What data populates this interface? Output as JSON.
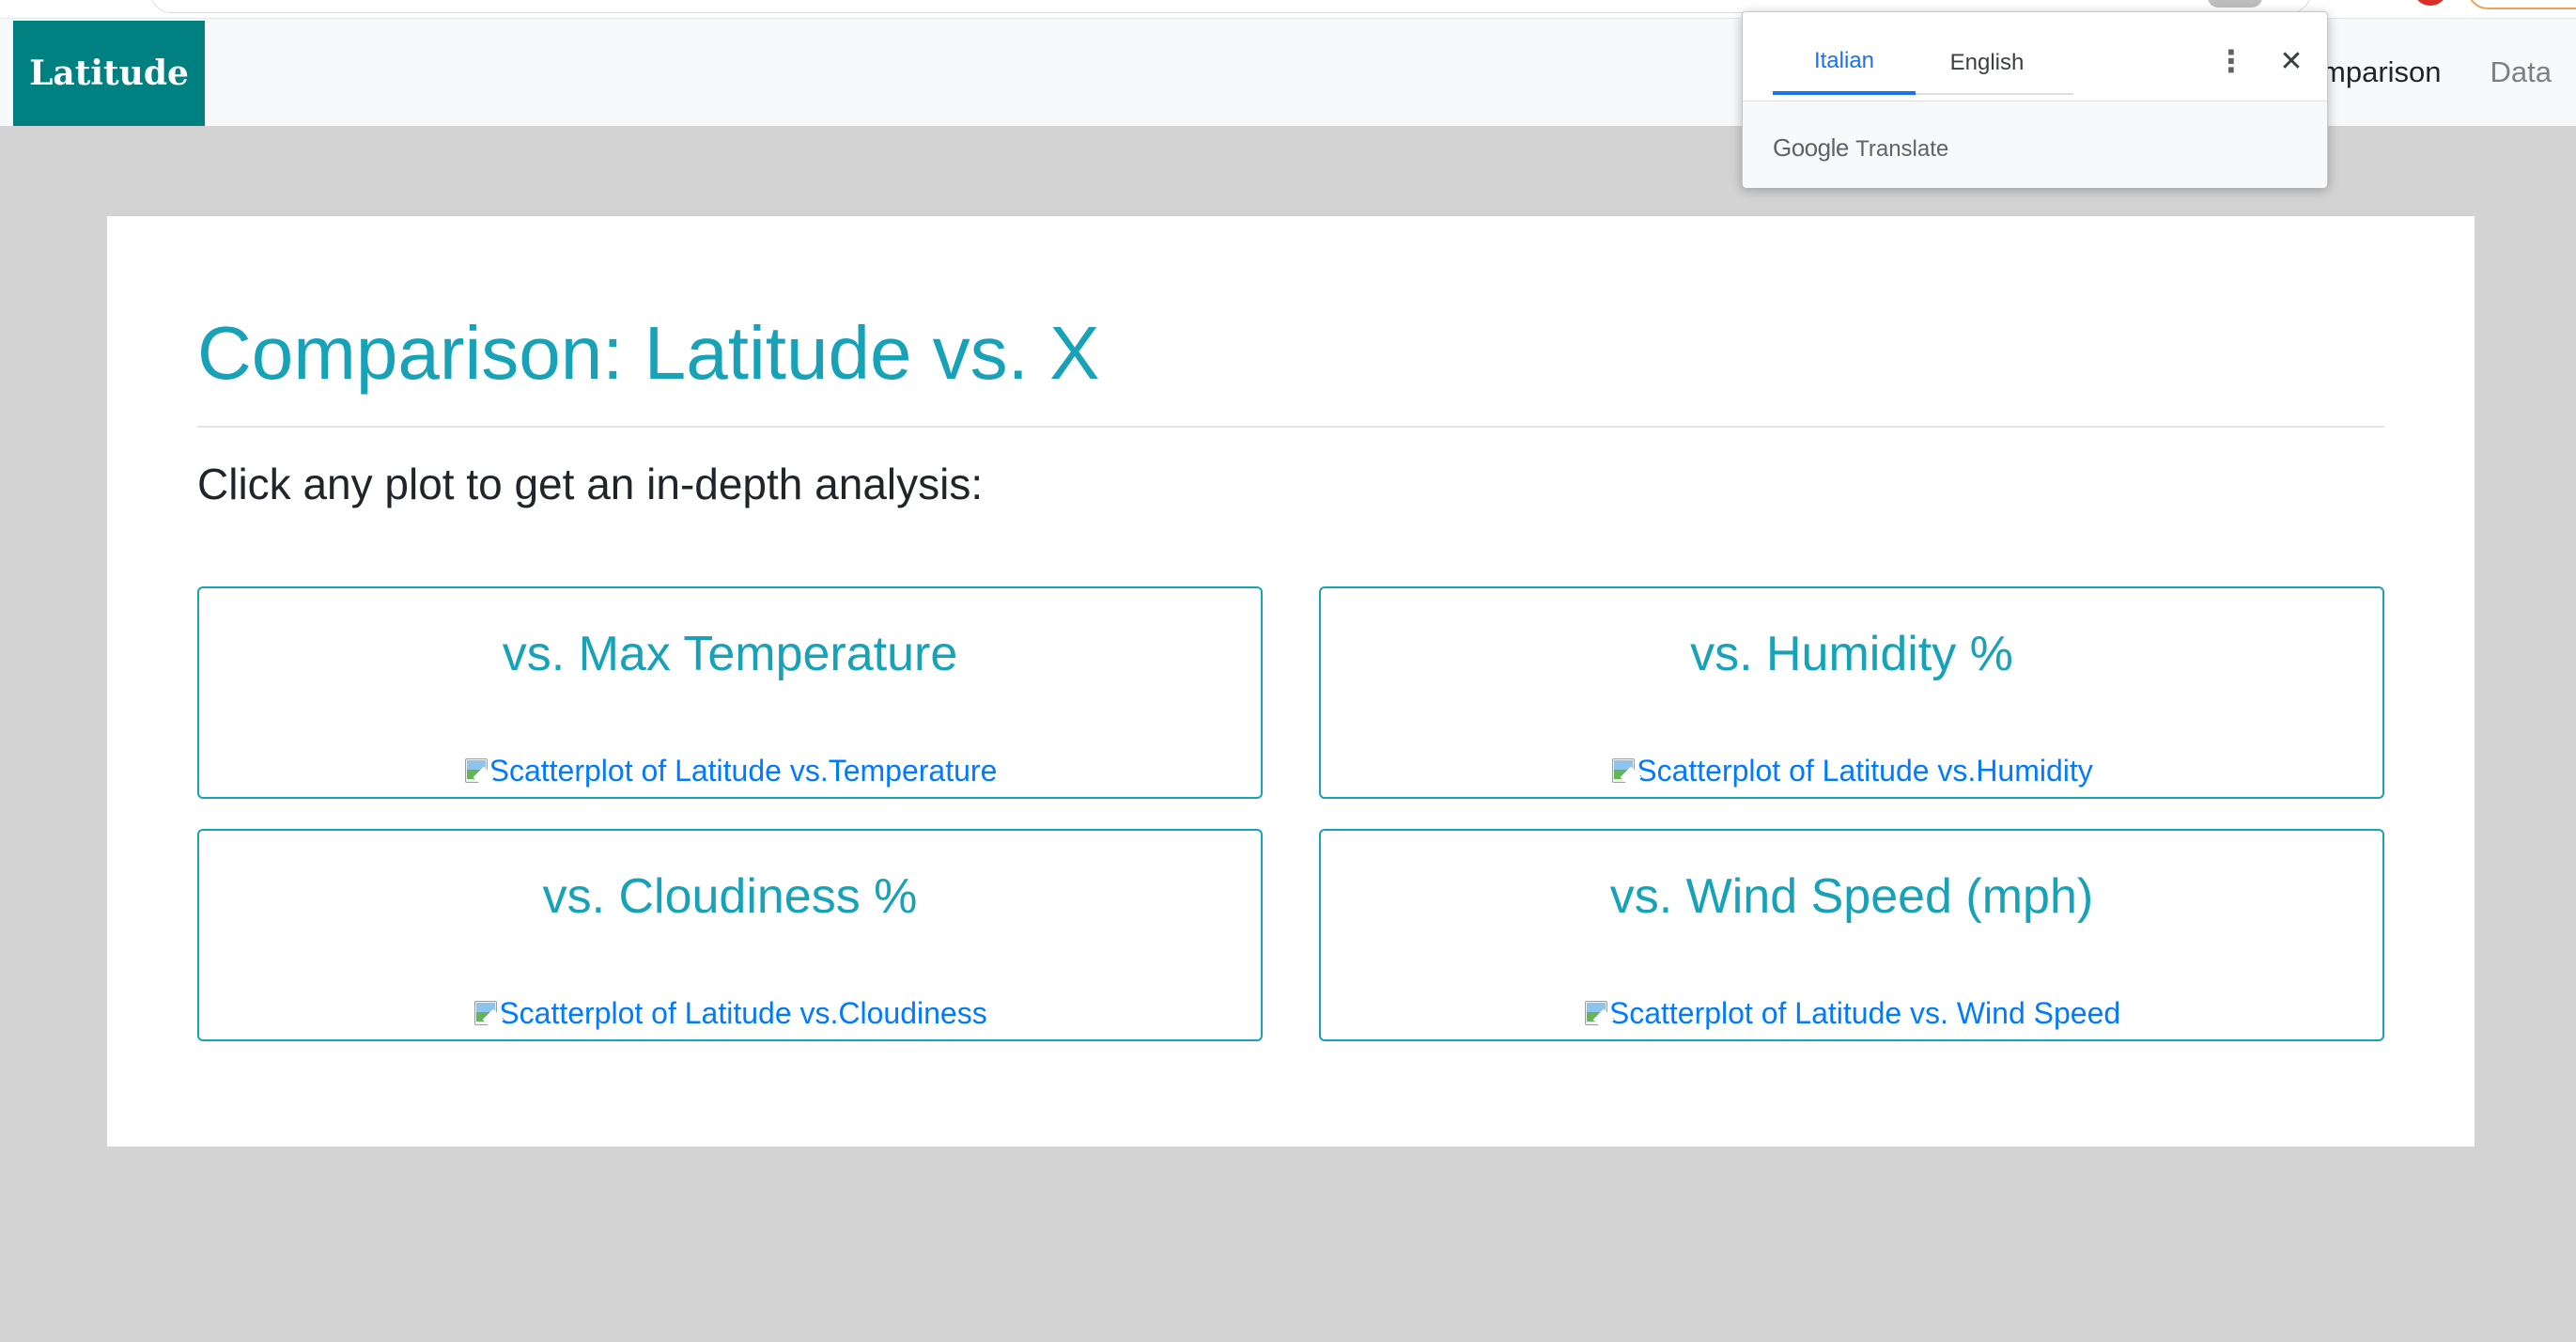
{
  "navbar": {
    "brand": "Latitude",
    "links": {
      "comparison": "mparison",
      "data": "Data"
    }
  },
  "translate_popup": {
    "tabs": [
      "Italian",
      "English"
    ],
    "selected_tab": "Italian",
    "brand_google": "Google",
    "brand_translate": "Translate",
    "accent_color": "#1a73e8"
  },
  "page": {
    "title": "Comparison: Latitude vs. X",
    "instruction": "Click any plot to get an in-depth analysis:",
    "accent_color": "#17a2b8",
    "link_color": "#007bff",
    "cards": [
      {
        "title": "vs. Max Temperature",
        "image_alt": "Scatterplot of Latitude vs.Temperature"
      },
      {
        "title": "vs. Humidity %",
        "image_alt": "Scatterplot of Latitude vs.Humidity"
      },
      {
        "title": "vs. Cloudiness %",
        "image_alt": "Scatterplot of Latitude vs.Cloudiness"
      },
      {
        "title": "vs. Wind Speed (mph)",
        "image_alt": "Scatterplot of Latitude vs. Wind Speed"
      }
    ]
  }
}
